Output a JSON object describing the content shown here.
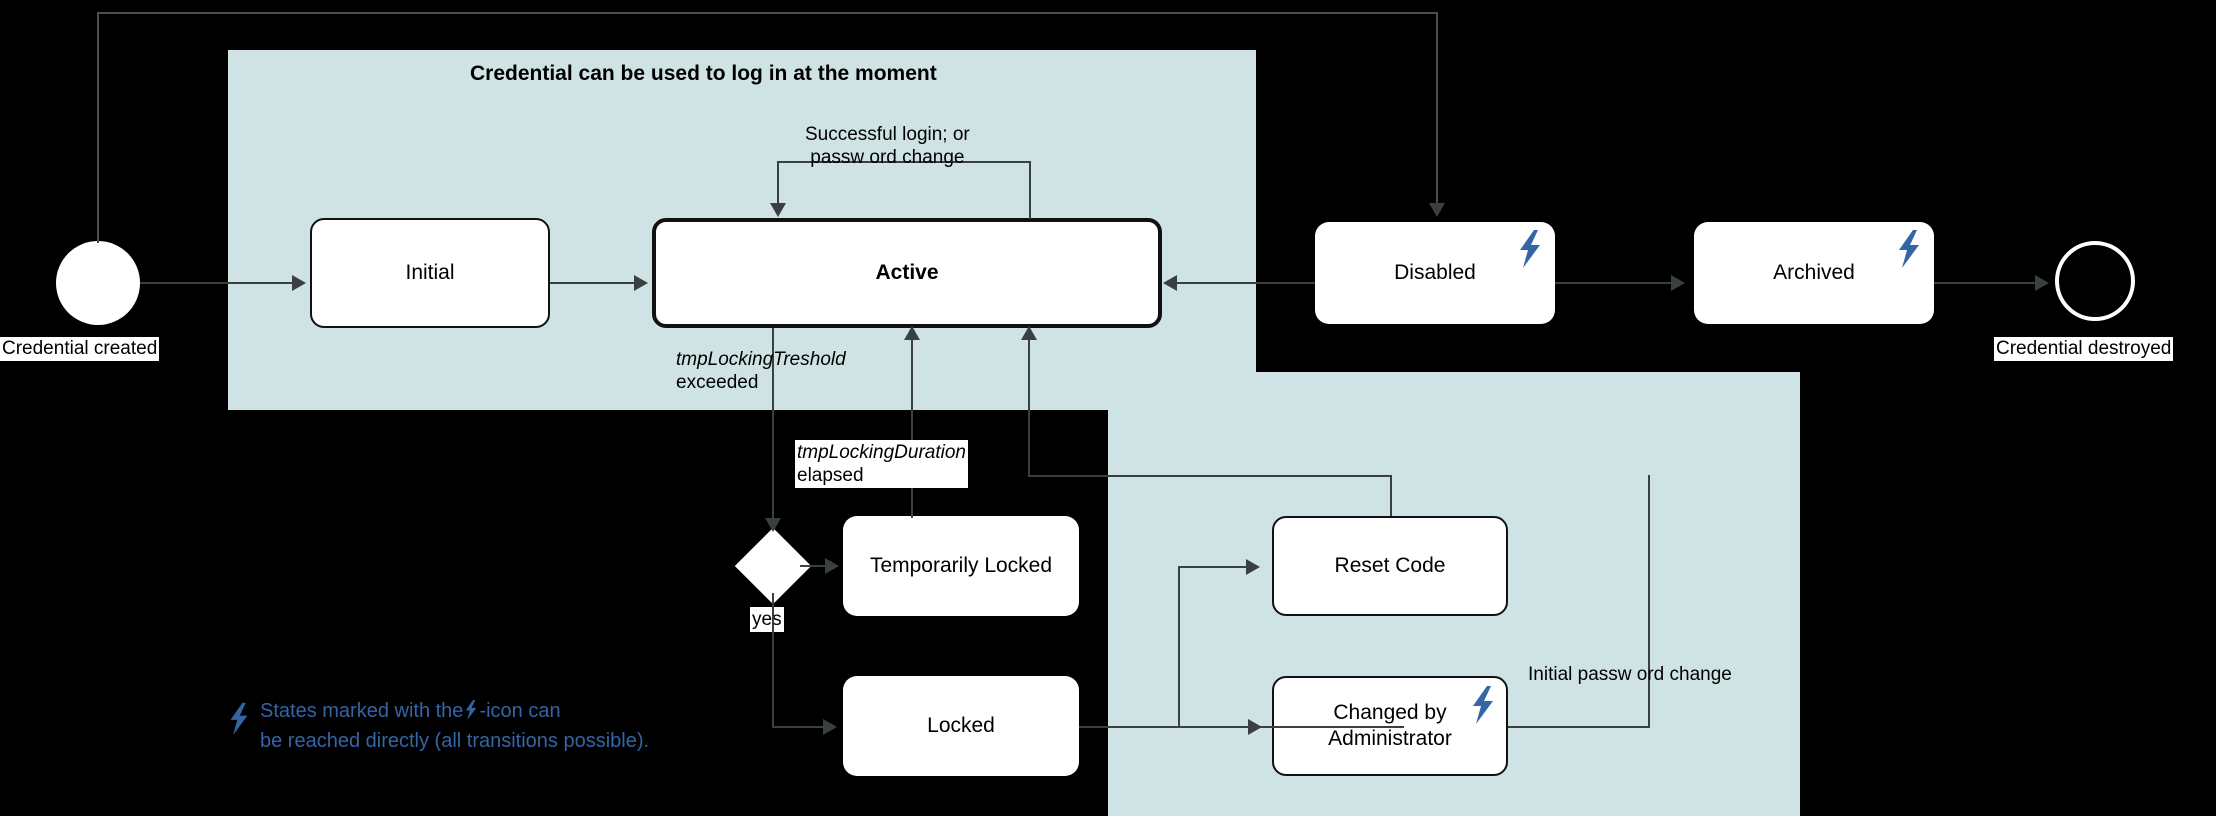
{
  "diagram": {
    "title": "Credential lifecycle state machine",
    "background_color": "#000000",
    "region_color": "#cfe3e4",
    "accent_color": "#3465a4",
    "line_color": "#3a3f42"
  },
  "regions": [
    {
      "name": "active-region",
      "title": "Credential can be used to log in at the moment"
    },
    {
      "name": "admin-region",
      "title": ""
    }
  ],
  "pseudostates": {
    "start": {
      "label": "Credential created",
      "icon": "filled-circle-icon"
    },
    "end": {
      "label": "Credential destroyed",
      "icon": "ring-circle-icon"
    },
    "decision": {
      "label": "yes",
      "icon": "diamond-icon"
    }
  },
  "states": [
    {
      "id": "initial",
      "label": "Initial",
      "bolt": false,
      "emphasis": false
    },
    {
      "id": "active",
      "label": "Active",
      "bolt": false,
      "emphasis": true
    },
    {
      "id": "disabled",
      "label": "Disabled",
      "bolt": true,
      "emphasis": false
    },
    {
      "id": "archived",
      "label": "Archived",
      "bolt": true,
      "emphasis": false
    },
    {
      "id": "temporarily-locked",
      "label": "Temporarily  Locked",
      "bolt": false,
      "emphasis": false
    },
    {
      "id": "locked",
      "label": "Locked",
      "bolt": false,
      "emphasis": false
    },
    {
      "id": "reset-code",
      "label": "Reset Code",
      "bolt": false,
      "emphasis": false
    },
    {
      "id": "changed-by-administrator",
      "label_line1": "Changed by",
      "label_line2": "Administrator",
      "bolt": true,
      "emphasis": false
    }
  ],
  "transitions": {
    "self_login": {
      "line1": "Successful login; or",
      "line2": "passw ord change"
    },
    "tmp_threshold": {
      "line1": "tmpLockingTreshold",
      "line1_italic": true,
      "line2": "exceeded"
    },
    "tmp_duration": {
      "line1": "tmpLockingDuration",
      "line1_italic": true,
      "line2": "elapsed"
    },
    "decision_yes": {
      "label": "yes"
    },
    "initial_password_change": {
      "label": "Initial passw ord change"
    }
  },
  "legend": {
    "icon": "lightning-bolt-icon",
    "line1_before": "States marked with the",
    "line1_after": "-icon can",
    "line2": "be reached directly (all transitions possible).",
    "color": "#3465a4"
  }
}
